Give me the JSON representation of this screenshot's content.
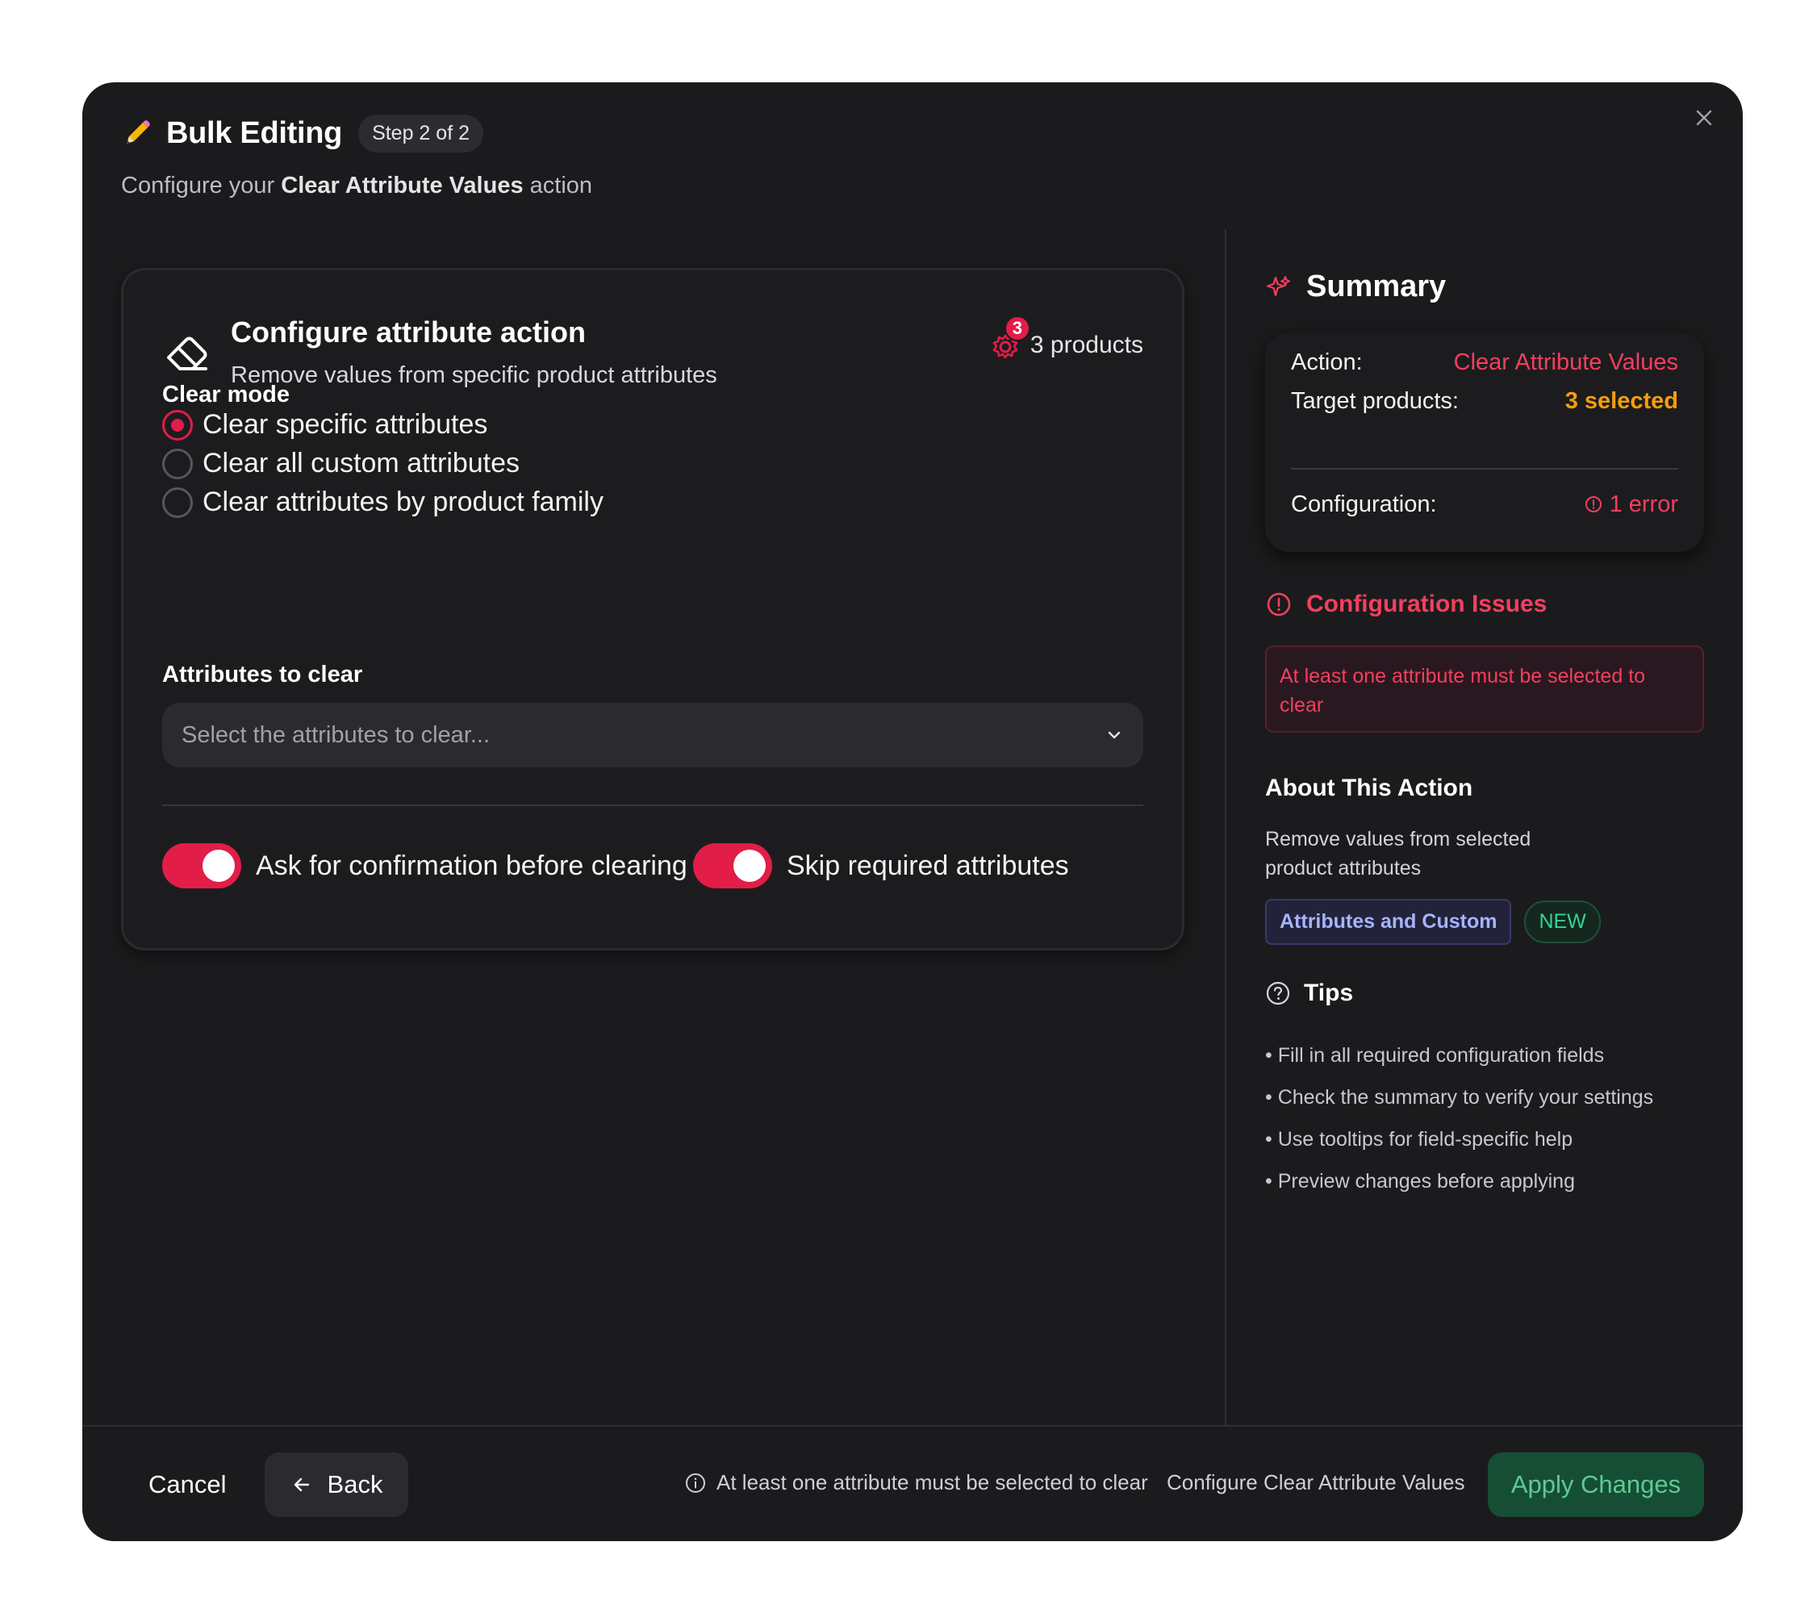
{
  "header": {
    "title": "Bulk Editing",
    "step": "Step 2 of 2",
    "subtitle_prefix": "Configure your ",
    "subtitle_action": "Clear Attribute Values",
    "subtitle_suffix": " action"
  },
  "card": {
    "title": "Configure attribute action",
    "description": "Remove values from specific product attributes",
    "products_count": "3",
    "products_label": "3 products",
    "clear_mode_label": "Clear mode",
    "clear_modes": [
      {
        "label": "Clear specific attributes",
        "checked": true
      },
      {
        "label": "Clear all custom attributes",
        "checked": false
      },
      {
        "label": "Clear attributes by product family",
        "checked": false
      }
    ],
    "attributes_label": "Attributes to clear",
    "attributes_placeholder": "Select the attributes to clear...",
    "toggles": [
      {
        "label": "Ask for confirmation before clearing",
        "on": true
      },
      {
        "label": "Skip required attributes",
        "on": true
      }
    ]
  },
  "summary": {
    "title": "Summary",
    "action_key": "Action:",
    "action_value": "Clear Attribute Values",
    "target_key": "Target products:",
    "target_value": "3 selected",
    "config_key": "Configuration:",
    "config_value": "1 error"
  },
  "issues": {
    "title": "Configuration Issues",
    "message": "At least one attribute must be selected to clear"
  },
  "about": {
    "title": "About This Action",
    "description": "Remove values from selected product attributes",
    "tag": "Attributes and Custom",
    "badge": "NEW"
  },
  "tips": {
    "title": "Tips",
    "items": [
      "Fill in all required configuration fields",
      "Check the summary to verify your settings",
      "Use tooltips for field-specific help",
      "Preview changes before applying"
    ]
  },
  "footer": {
    "cancel": "Cancel",
    "back": "Back",
    "message": "At least one attribute must be selected to clear",
    "configure": "Configure Clear Attribute Values",
    "apply": "Apply Changes"
  },
  "colors": {
    "accent": "#e11d48",
    "warning": "#f59e0b",
    "apply_bg": "#15573a",
    "modal_bg": "#1b1b1d"
  }
}
